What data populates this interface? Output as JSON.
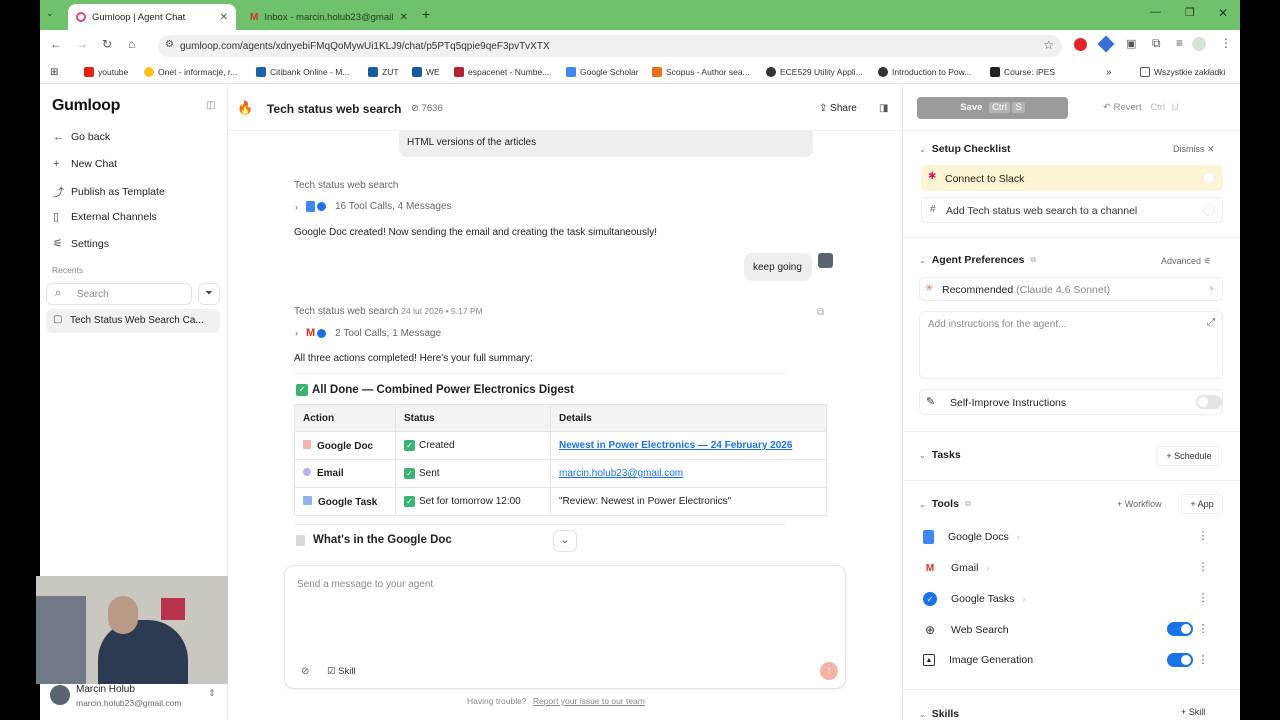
{
  "browser": {
    "tabs": [
      {
        "title": "Gumloop | Agent Chat",
        "active": true
      },
      {
        "title": "Inbox - marcin.holub23@gmail",
        "active": false
      }
    ],
    "url": "gumloop.com/agents/xdnyebiFMqQoMywUi1KLJ9/chat/p5PTq5qpie9qeF3pvTvXTX",
    "bookmarks": [
      "youtube",
      "Onet - informacje, r...",
      "Citibank Online - M...",
      "ZUT",
      "WE",
      "espacenet - Numbe...",
      "Google Scholar",
      "Scopus - Author sea...",
      "ECE529 Utility Appli...",
      "Introduction to Pow...",
      "Course: iPES"
    ],
    "bookmarks_folder": "Wszystkie zakładki"
  },
  "sidebar": {
    "logo": "Gumloop",
    "nav": [
      "Go back",
      "New Chat",
      "Publish as Template",
      "External Channels",
      "Settings"
    ],
    "recents_label": "Recents",
    "search_placeholder": "Search",
    "recent_item": "Tech Status Web Search Ca...",
    "user": {
      "name": "Marcin Holub",
      "email": "marcin.holub23@gmail.com"
    }
  },
  "chat": {
    "title": "Tech status web search",
    "count": "7636",
    "share_label": "Share",
    "prev_bubble": "HTML versions of the articles",
    "msg1": {
      "sender": "Tech status web search",
      "tools": "16 Tool Calls, 4 Messages",
      "text": "Google Doc created! Now sending the email and creating the task simultaneously!"
    },
    "user_msg": "keep going",
    "msg2": {
      "sender": "Tech status web search",
      "timestamp": "24 lut 2026 • 5:17 PM",
      "tools": "2 Tool Calls, 1 Message",
      "text": "All three actions completed! Here's your full summary:",
      "heading": "All Done — Combined Power Electronics Digest",
      "table": {
        "headers": [
          "Action",
          "Status",
          "Details"
        ],
        "rows": [
          {
            "action": "Google Doc",
            "status": "Created",
            "details": "Newest in Power Electronics — 24 February 2026"
          },
          {
            "action": "Email",
            "status": "Sent",
            "details": "marcin.holub23@gmail.com"
          },
          {
            "action": "Google Task",
            "status": "Set for tomorrow 12:00",
            "details": "\"Review: Newest in Power Electronics\""
          }
        ]
      },
      "subheading": "What's in the Google Doc"
    },
    "composer_placeholder": "Send a message to your agent",
    "skill_label": "Skill",
    "footer": "Having trouble?",
    "footer_link": "Report your issue to our team"
  },
  "right": {
    "save_label": "Save",
    "save_keys": [
      "Ctrl",
      "S"
    ],
    "revert_label": "Revert",
    "revert_keys": [
      "Ctrl",
      "U"
    ],
    "setup_title": "Setup Checklist",
    "dismiss_label": "Dismiss",
    "checklist": [
      "Connect to Slack",
      "Add Tech status web search to a channel"
    ],
    "prefs_title": "Agent Preferences",
    "advanced_label": "Advanced",
    "model_label": "Recommended",
    "model_name": "(Claude 4.6 Sonnet)",
    "instructions_placeholder": "Add instructions for the agent...",
    "self_improve": "Self-Improve Instructions",
    "tasks_title": "Tasks",
    "schedule_label": "Schedule",
    "tools_title": "Tools",
    "workflow_label": "Workflow",
    "app_label": "App",
    "tools": [
      {
        "name": "Google Docs",
        "icon": "google-docs-icon"
      },
      {
        "name": "Gmail",
        "icon": "gmail-icon"
      },
      {
        "name": "Google Tasks",
        "icon": "google-tasks-icon"
      },
      {
        "name": "Web Search",
        "icon": "globe-icon",
        "toggle": true
      },
      {
        "name": "Image Generation",
        "icon": "image-icon",
        "toggle": true
      }
    ],
    "skills_title": "Skills",
    "skill_add_label": "Skill"
  },
  "colors": {
    "chrome_green": "#6fc16b",
    "accent_blue": "#1a73e8",
    "slack_highlight": "#fdf4d3"
  }
}
